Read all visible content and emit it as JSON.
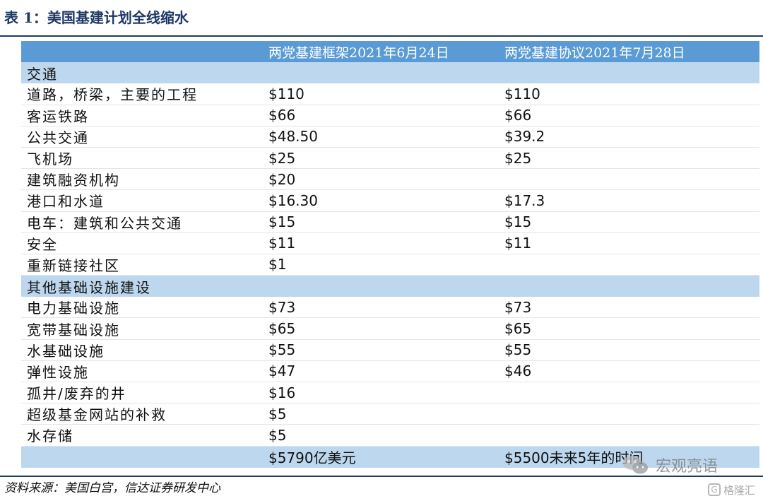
{
  "title": "表 1：美国基建计划全线缩水",
  "table": {
    "headers": [
      "",
      "两党基建框架2021年6月24日",
      "两党基建协议2021年7月28日"
    ],
    "rows": [
      {
        "type": "section",
        "label": "交通",
        "v1": "",
        "v2": ""
      },
      {
        "type": "data",
        "label": "道路，桥梁，主要的工程",
        "v1": "$110",
        "v2": "$110"
      },
      {
        "type": "data",
        "label": "客运铁路",
        "v1": "$66",
        "v2": "$66"
      },
      {
        "type": "data",
        "label": "公共交通",
        "v1": "$48.50",
        "v2": "$39.2"
      },
      {
        "type": "data",
        "label": "飞机场",
        "v1": "$25",
        "v2": "$25"
      },
      {
        "type": "data",
        "label": "建筑融资机构",
        "v1": "$20",
        "v2": ""
      },
      {
        "type": "data",
        "label": "港口和水道",
        "v1": "$16.30",
        "v2": "$17.3"
      },
      {
        "type": "data",
        "label": "电车：建筑和公共交通",
        "v1": "$15",
        "v2": "$15"
      },
      {
        "type": "data",
        "label": "安全",
        "v1": "$11",
        "v2": "$11"
      },
      {
        "type": "data",
        "label": "重新链接社区",
        "v1": "$1",
        "v2": ""
      },
      {
        "type": "section",
        "label": "其他基础设施建设",
        "v1": "",
        "v2": ""
      },
      {
        "type": "data",
        "label": "电力基础设施",
        "v1": "$73",
        "v2": "$73"
      },
      {
        "type": "data",
        "label": "宽带基础设施",
        "v1": "$65",
        "v2": "$65"
      },
      {
        "type": "data",
        "label": "水基础设施",
        "v1": "$55",
        "v2": "$55"
      },
      {
        "type": "data",
        "label": "弹性设施",
        "v1": "$47",
        "v2": "$46"
      },
      {
        "type": "data",
        "label": "孤井/废弃的井",
        "v1": "$16",
        "v2": ""
      },
      {
        "type": "data",
        "label": "超级基金网站的补救",
        "v1": "$5",
        "v2": ""
      },
      {
        "type": "data",
        "label": "水存储",
        "v1": "$5",
        "v2": ""
      },
      {
        "type": "total",
        "label": "",
        "v1": "$5790亿美元",
        "v2": "$5500未来5年的时间"
      }
    ]
  },
  "source": "资料来源：美国白宫，信达证券研发中心",
  "watermarks": {
    "wechat_text": "宏观亮语",
    "gelonghui_text": "格隆汇",
    "wechat_icon": "wechat-icon",
    "gelonghui_icon": "gelonghui-logo-icon"
  },
  "colors": {
    "title": "#1f3864",
    "header_bg": "#5b9bd5",
    "section_bg": "#bdd7ee"
  }
}
